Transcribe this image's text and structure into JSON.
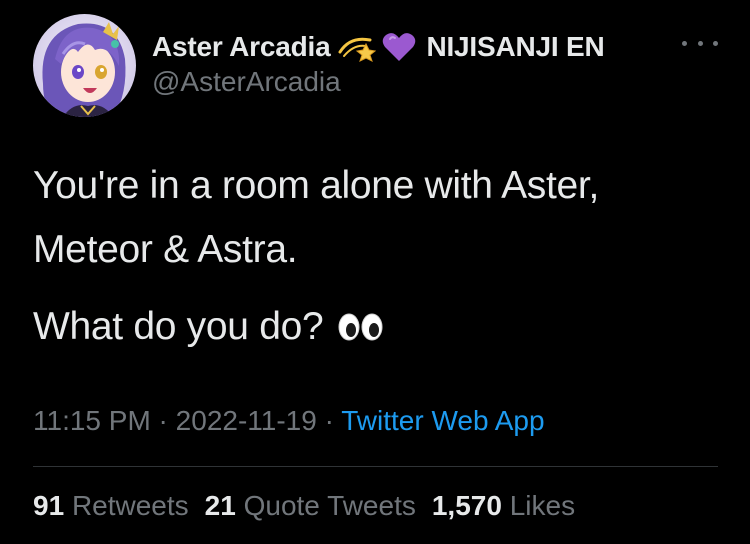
{
  "author": {
    "display_name": "Aster Arcadia",
    "affiliation": "NIJISANJI EN",
    "handle": "@AsterArcadia",
    "badges": [
      "dizzy-star-emoji",
      "purple-heart-emoji"
    ]
  },
  "tweet": {
    "line1": "You're in a room alone with Aster,",
    "line2": "Meteor & Astra.",
    "line3": "What do you do?",
    "line3_emoji": "eyes-emoji"
  },
  "meta": {
    "time": "11:15 PM",
    "sep1": " · ",
    "date": "2022-11-19",
    "sep2": " · ",
    "source": "Twitter Web App"
  },
  "stats": {
    "retweets": {
      "count": "91",
      "label": "Retweets"
    },
    "quotes": {
      "count": "21",
      "label": "Quote Tweets"
    },
    "likes": {
      "count": "1,570",
      "label": "Likes"
    }
  },
  "colors": {
    "background": "#000000",
    "text": "#e7e9ea",
    "muted": "#71767b",
    "link": "#1d9bf0",
    "divider": "#2f3336"
  }
}
